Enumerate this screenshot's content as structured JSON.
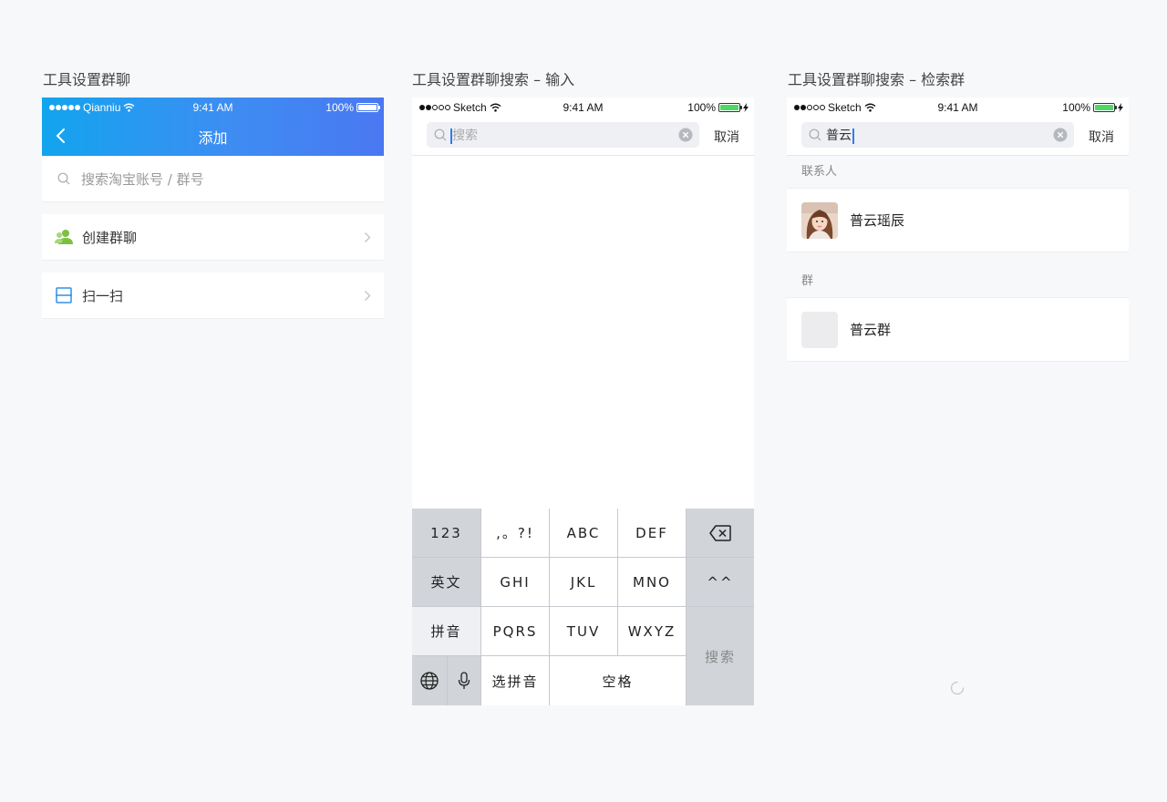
{
  "frames": [
    {
      "title": "工具设置群聊",
      "status": {
        "carrier": "Qianniu",
        "time": "9:41 AM",
        "battery": "100%"
      },
      "nav": {
        "title": "添加"
      },
      "search": {
        "placeholder": "搜索淘宝账号 / 群号"
      },
      "items": [
        {
          "label": "创建群聊",
          "icon": "group-user-icon",
          "color": "#7bc043"
        },
        {
          "label": "扫一扫",
          "icon": "scan-icon",
          "color": "#2e91e8"
        }
      ]
    },
    {
      "title": "工具设置群聊搜索 – 输入",
      "status": {
        "carrier": "Sketch",
        "time": "9:41 AM",
        "battery": "100%"
      },
      "search": {
        "placeholder": "搜索",
        "cancel": "取消"
      },
      "keyboard": {
        "row1": [
          "123",
          ",。?!",
          "ABC",
          "DEF"
        ],
        "row2": [
          "英文",
          "GHI",
          "JKL",
          "MNO",
          "^^"
        ],
        "row3": [
          "拼音",
          "PQRS",
          "TUV",
          "WXYZ"
        ],
        "row4": [
          "选拼音",
          "空格"
        ],
        "search_key": "搜索",
        "icons": [
          "backspace-icon",
          "globe-icon",
          "microphone-icon"
        ]
      }
    },
    {
      "title": "工具设置群聊搜索 – 检索群",
      "status": {
        "carrier": "Sketch",
        "time": "9:41 AM",
        "battery": "100%"
      },
      "search": {
        "value": "普云",
        "cancel": "取消"
      },
      "sections": [
        {
          "label": "联系人",
          "results": [
            {
              "name": "普云瑶辰",
              "avatar": "photo"
            }
          ]
        },
        {
          "label": "群",
          "results": [
            {
              "name": "普云群",
              "avatar": "blank"
            }
          ]
        }
      ]
    }
  ],
  "colors": {
    "accent": "#2b7cf6",
    "nav_gradient_start": "#12a4ee",
    "nav_gradient_end": "#4a78f2",
    "battery_green": "#4cd964"
  }
}
